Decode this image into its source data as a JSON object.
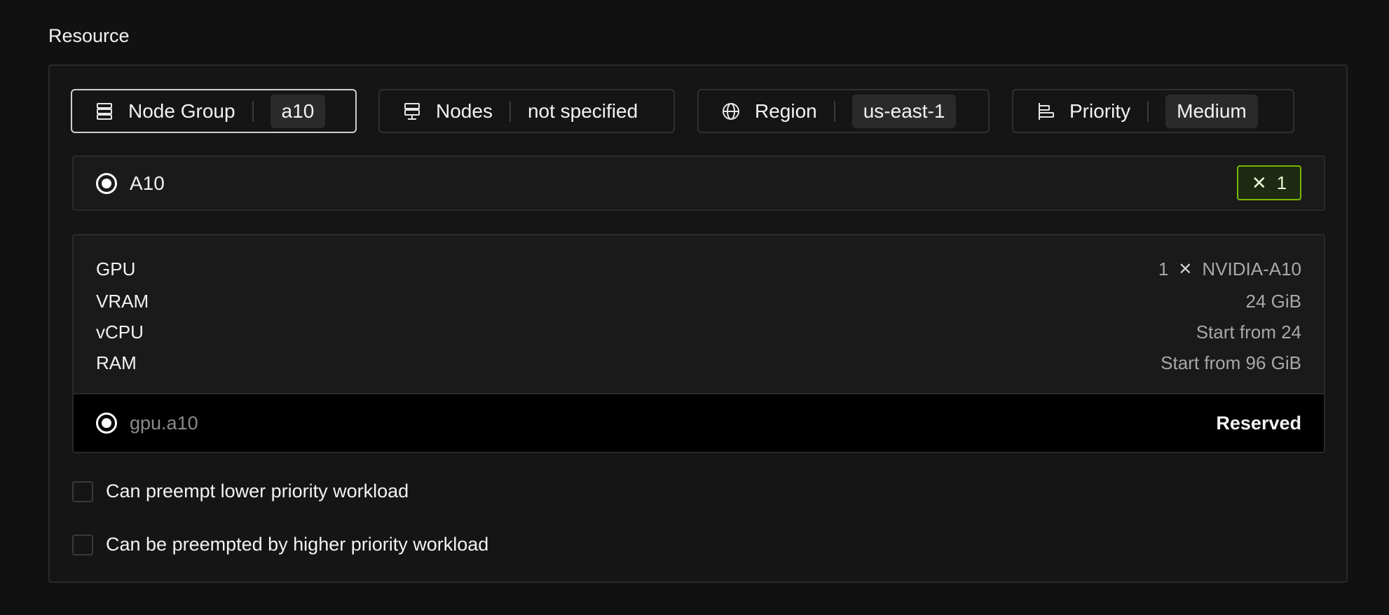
{
  "section": {
    "title": "Resource"
  },
  "filters": [
    {
      "label": "Node Group",
      "value": "a10",
      "icon": "server-stack-icon"
    },
    {
      "label": "Nodes",
      "value": "not specified",
      "icon": "server-icon"
    },
    {
      "label": "Region",
      "value": "us-east-1",
      "icon": "globe-icon"
    },
    {
      "label": "Priority",
      "value": "Medium",
      "icon": "priority-icon"
    }
  ],
  "node_group_option": {
    "label": "A10",
    "count_symbol": "✕",
    "count": "1",
    "accent": "#76b900"
  },
  "specs": {
    "gpu": {
      "key": "GPU",
      "count": "1",
      "symbol": "✕",
      "model": "NVIDIA-A10"
    },
    "vram": {
      "key": "VRAM",
      "value": "24 GiB"
    },
    "vcpu": {
      "key": "vCPU",
      "value": "Start from 24"
    },
    "ram": {
      "key": "RAM",
      "value": "Start from 96 GiB"
    }
  },
  "instance": {
    "name": "gpu.a10",
    "status": "Reserved"
  },
  "options": [
    {
      "label": "Can preempt lower priority workload",
      "checked": false
    },
    {
      "label": "Can be preempted by higher priority workload",
      "checked": false
    }
  ]
}
